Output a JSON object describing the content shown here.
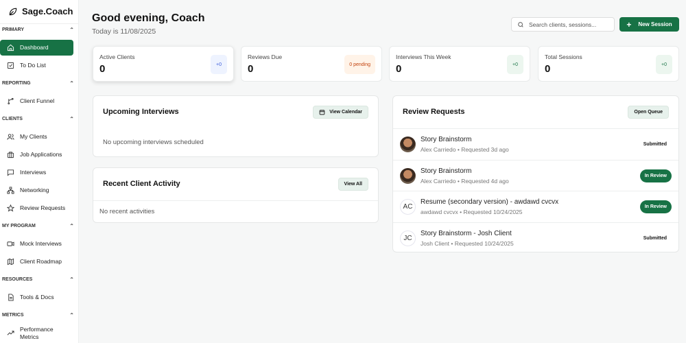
{
  "app": {
    "name": "Sage.Coach"
  },
  "sidebar": {
    "sections": [
      {
        "label": "PRIMARY",
        "items": [
          {
            "label": "Dashboard",
            "icon": "home-icon",
            "active": true
          },
          {
            "label": "To Do List",
            "icon": "checkbox-icon"
          }
        ]
      },
      {
        "label": "REPORTING",
        "items": [
          {
            "label": "Client Funnel",
            "icon": "funnel-branch-icon"
          }
        ]
      },
      {
        "label": "CLIENTS",
        "items": [
          {
            "label": "My Clients",
            "icon": "users-icon"
          },
          {
            "label": "Job Applications",
            "icon": "briefcase-icon"
          },
          {
            "label": "Interviews",
            "icon": "message-icon"
          },
          {
            "label": "Networking",
            "icon": "network-icon"
          },
          {
            "label": "Review Requests",
            "icon": "star-icon"
          }
        ]
      },
      {
        "label": "MY PROGRAM",
        "items": [
          {
            "label": "Mock Interviews",
            "icon": "video-icon"
          },
          {
            "label": "Client Roadmap",
            "icon": "map-icon"
          }
        ]
      },
      {
        "label": "RESOURCES",
        "items": [
          {
            "label": "Tools & Docs",
            "icon": "document-icon"
          }
        ]
      },
      {
        "label": "METRICS",
        "items": [
          {
            "label": "Performance Metrics",
            "icon": "trending-up-icon"
          }
        ]
      }
    ]
  },
  "header": {
    "title": "Good evening, Coach",
    "date": "Today is 11/08/2025",
    "search_placeholder": "Search clients, sessions...",
    "new_session": "New Session"
  },
  "stats": [
    {
      "label": "Active Clients",
      "value": "0",
      "badge": "+0",
      "badge_bg": "#eef3ff",
      "badge_color": "#3b5bdb"
    },
    {
      "label": "Reviews Due",
      "value": "0",
      "badge": "0 pending",
      "badge_bg": "#fff3e8",
      "badge_color": "#c2410c"
    },
    {
      "label": "Interviews This Week",
      "value": "0",
      "badge": "+0",
      "badge_bg": "#ecf6ef",
      "badge_color": "#177245"
    },
    {
      "label": "Total Sessions",
      "value": "0",
      "badge": "+0",
      "badge_bg": "#ecf6ef",
      "badge_color": "#177245"
    }
  ],
  "upcoming": {
    "title": "Upcoming Interviews",
    "button": "View Calendar",
    "empty": "No upcoming interviews scheduled"
  },
  "activity": {
    "title": "Recent Client Activity",
    "button": "View All",
    "empty": "No recent activities"
  },
  "reviews": {
    "title": "Review Requests",
    "button": "Open Queue",
    "rows": [
      {
        "title": "Story Brainstorm",
        "sub": "Alex Carriedo • Requested 3d ago",
        "status": "Submitted",
        "avatar": "photo"
      },
      {
        "title": "Story Brainstorm",
        "sub": "Alex Carriedo • Requested 4d ago",
        "status": "In Review",
        "avatar": "photo"
      },
      {
        "title": "Resume (secondary version) - awdawd cvcvx",
        "sub": "awdawd cvcvx • Requested 10/24/2025",
        "status": "In Review",
        "avatar": "AC"
      },
      {
        "title": "Story Brainstorm - Josh Client",
        "sub": "Josh Client • Requested 10/24/2025",
        "status": "Submitted",
        "avatar": "JC"
      }
    ]
  }
}
